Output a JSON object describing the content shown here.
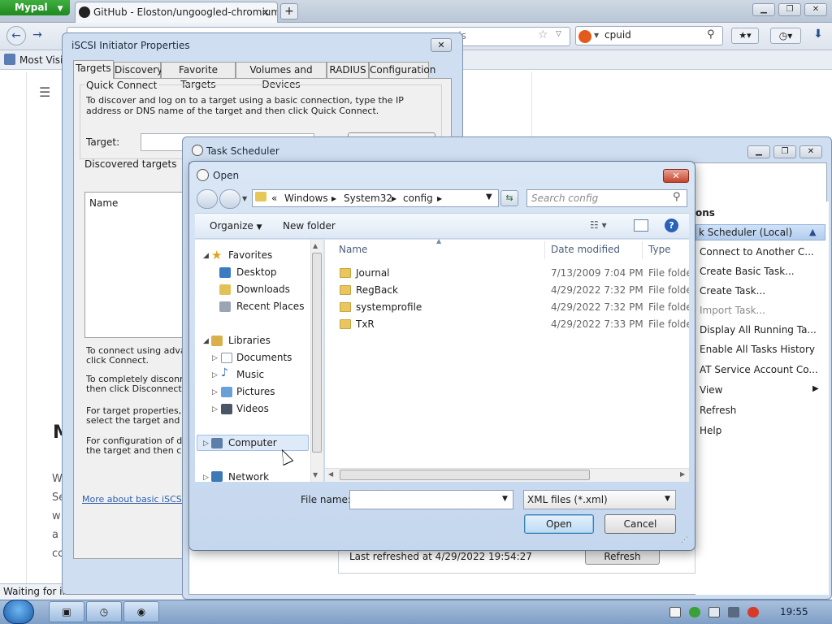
{
  "browser": {
    "app_menu": "Mypal",
    "tab_title": "GitHub - Eloston/ungoogled-chromium...",
    "tab_close": "×",
    "new_tab": "+",
    "url_partial": "ds",
    "search_value": "cpuid",
    "bookmark_most_visited": "Most Visit",
    "status": "Waiting for in",
    "page_text_fragments": [
      "M",
      "W",
      "Se",
      "w",
      "a",
      "cc"
    ]
  },
  "iscsi": {
    "title": "iSCSI Initiator Properties",
    "tabs": [
      "Targets",
      "Discovery",
      "Favorite Targets",
      "Volumes and Devices",
      "RADIUS",
      "Configuration"
    ],
    "active_tab": "Targets",
    "quick_connect_legend": "Quick Connect",
    "quick_connect_desc": "To discover and log on to a target using a basic connection, type the IP address or DNS name of the target and then click Quick Connect.",
    "target_label": "Target:",
    "discovered_targets_legend": "Discovered targets",
    "list_col_name": "Name",
    "paragraphs": [
      [
        "To connect using advanc",
        "click Connect."
      ],
      [
        "To completely disconnect",
        "then click Disconnect."
      ],
      [
        "For target properties, in",
        "select the target and clic"
      ],
      [
        "For configuration of devi",
        "the target and then click"
      ]
    ],
    "link": "More about basic iSCSI c"
  },
  "task_scheduler": {
    "title": "Task Scheduler",
    "actions_header": "ons",
    "actions_selected": "k Scheduler (Local)",
    "actions": [
      {
        "label": "Connect to Another C...",
        "enabled": true
      },
      {
        "label": "Create Basic Task...",
        "enabled": true
      },
      {
        "label": "Create Task...",
        "enabled": true
      },
      {
        "label": "Import Task...",
        "enabled": false
      },
      {
        "label": "Display All Running Ta...",
        "enabled": true
      },
      {
        "label": "Enable All Tasks History",
        "enabled": true
      },
      {
        "label": "AT Service Account Co...",
        "enabled": true
      },
      {
        "label": "View",
        "enabled": true
      },
      {
        "label": "Refresh",
        "enabled": true
      },
      {
        "label": "Help",
        "enabled": true
      }
    ],
    "last_refreshed": "Last refreshed at 4/29/2022 19:54:27",
    "refresh_button": "Refresh"
  },
  "open_dialog": {
    "title": "Open",
    "breadcrumb": [
      "«",
      "Windows",
      "System32",
      "config"
    ],
    "search_placeholder": "Search config",
    "toolbar": {
      "organize": "Organize",
      "new_folder": "New folder"
    },
    "nav": {
      "favorites": "Favorites",
      "favorites_items": [
        "Desktop",
        "Downloads",
        "Recent Places"
      ],
      "libraries": "Libraries",
      "libraries_items": [
        "Documents",
        "Music",
        "Pictures",
        "Videos"
      ],
      "computer": "Computer",
      "network": "Network"
    },
    "columns": {
      "name": "Name",
      "date": "Date modified",
      "type": "Type"
    },
    "files": [
      {
        "name": "Journal",
        "date": "7/13/2009 7:04 PM",
        "type": "File folder"
      },
      {
        "name": "RegBack",
        "date": "4/29/2022 7:32 PM",
        "type": "File folder"
      },
      {
        "name": "systemprofile",
        "date": "4/29/2022 7:32 PM",
        "type": "File folder"
      },
      {
        "name": "TxR",
        "date": "4/29/2022 7:33 PM",
        "type": "File folder"
      }
    ],
    "filename_label": "File name:",
    "filename_value": "",
    "filetype": "XML files (*.xml)",
    "open_button": "Open",
    "cancel_button": "Cancel"
  },
  "taskbar": {
    "clock": "19:55"
  }
}
